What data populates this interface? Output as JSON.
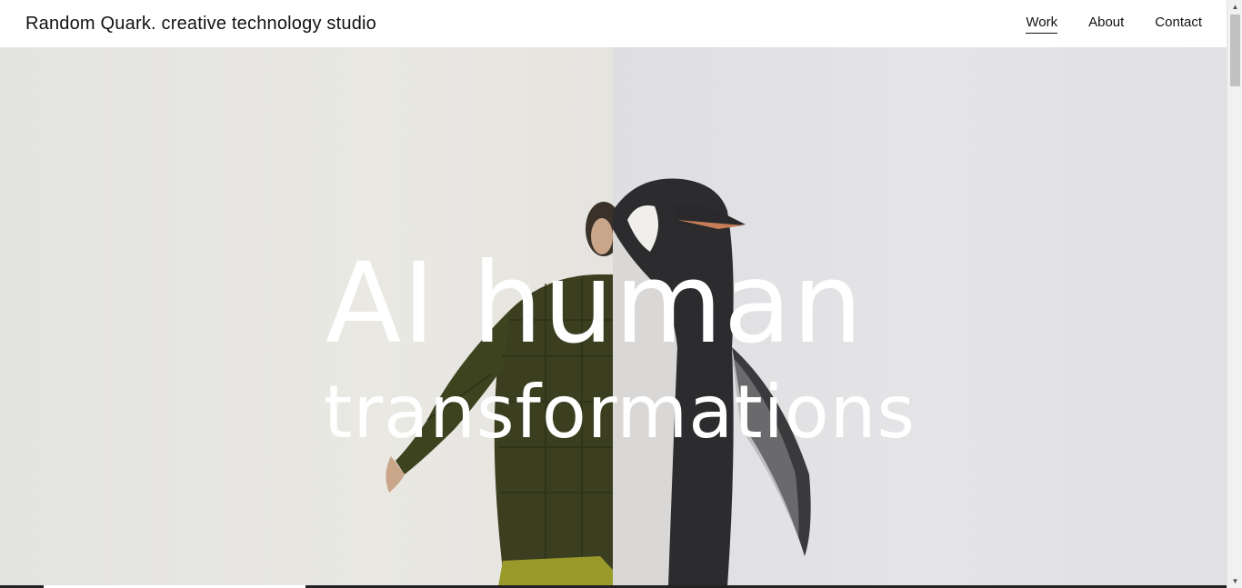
{
  "header": {
    "brand": "Random Quark. creative technology studio",
    "nav": [
      {
        "label": "Work",
        "active": true
      },
      {
        "label": "About",
        "active": false
      },
      {
        "label": "Contact",
        "active": false
      }
    ]
  },
  "hero": {
    "title_line1": "AI human",
    "title_line2": "transformations"
  },
  "progress": {
    "value": 0.21
  },
  "icons": {
    "scroll_up": "scroll-up-arrow-icon",
    "scroll_down": "scroll-down-arrow-icon"
  }
}
